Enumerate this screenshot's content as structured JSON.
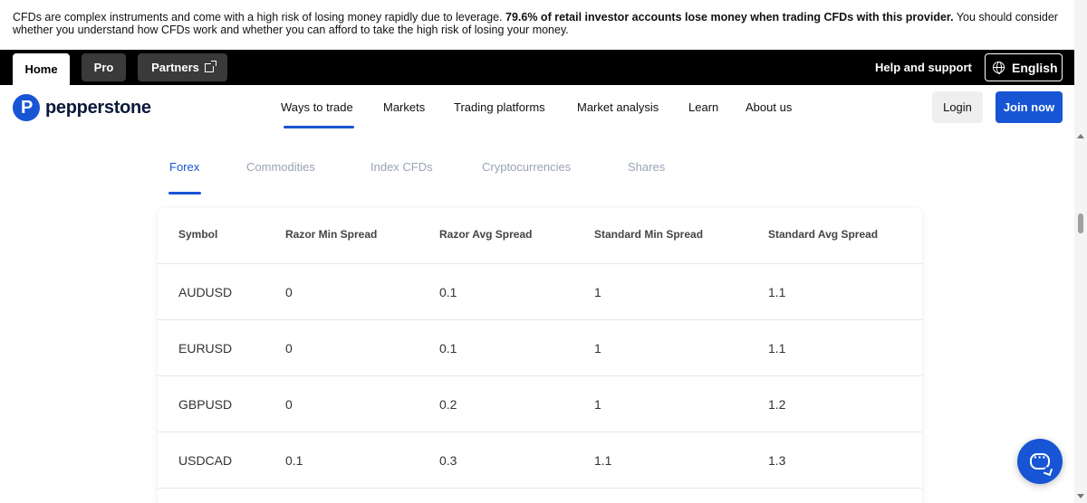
{
  "risk_warning": {
    "text_before": "CFDs are complex instruments and come with a high risk of losing money rapidly due to leverage. ",
    "bold": "79.6% of retail investor accounts lose money when trading CFDs with this provider.",
    "text_after": " You should consider whether you understand how CFDs work and whether you can afford to take the high risk of losing your money."
  },
  "topbar": {
    "tabs": [
      {
        "label": "Home"
      },
      {
        "label": "Pro"
      },
      {
        "label": "Partners"
      }
    ],
    "help_label": "Help and support",
    "language_label": "English"
  },
  "header": {
    "logo_text": "pepperstone",
    "logo_mark": "P",
    "nav": [
      {
        "label": "Ways to trade"
      },
      {
        "label": "Markets"
      },
      {
        "label": "Trading platforms"
      },
      {
        "label": "Market analysis"
      },
      {
        "label": "Learn"
      },
      {
        "label": "About us"
      }
    ],
    "login_label": "Login",
    "join_label": "Join now"
  },
  "market_tabs": [
    {
      "label": "Forex"
    },
    {
      "label": "Commodities"
    },
    {
      "label": "Index CFDs"
    },
    {
      "label": "Cryptocurrencies"
    },
    {
      "label": "Shares"
    }
  ],
  "table": {
    "headers": [
      "Symbol",
      "Razor Min Spread",
      "Razor Avg Spread",
      "Standard Min Spread",
      "Standard Avg Spread"
    ],
    "rows": [
      [
        "AUDUSD",
        "0",
        "0.1",
        "1",
        "1.1"
      ],
      [
        "EURUSD",
        "0",
        "0.1",
        "1",
        "1.1"
      ],
      [
        "GBPUSD",
        "0",
        "0.2",
        "1",
        "1.2"
      ],
      [
        "USDCAD",
        "0.1",
        "0.3",
        "1.1",
        "1.3"
      ]
    ]
  },
  "colors": {
    "brand_blue": "#1755d4",
    "topbar_black": "#000000",
    "inactive_tab_text": "#9aa3b5"
  },
  "icons": [
    "external-link-icon",
    "globe-icon",
    "chat-icon",
    "scroll-up-arrow-icon",
    "scroll-down-arrow-icon"
  ]
}
